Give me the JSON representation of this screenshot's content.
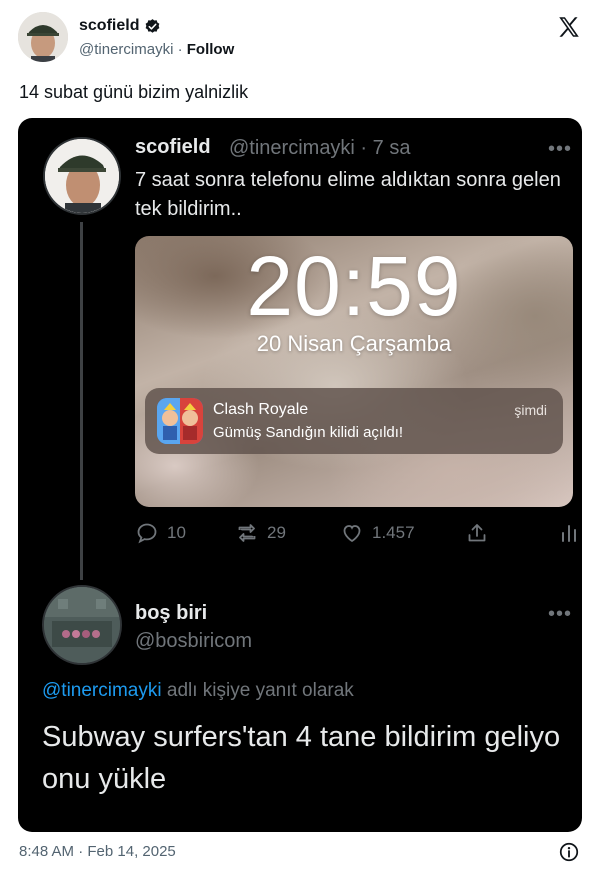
{
  "outer_tweet": {
    "author_name": "scofield",
    "handle": "@tinercimayki",
    "separator": "·",
    "follow_label": "Follow",
    "text": "14 subat günü bizim yalnizlik",
    "timestamp": "8:48 AM · Feb 14, 2025",
    "icons": {
      "verified": "verified-badge-icon",
      "logo": "x-logo-icon",
      "info": "info-icon"
    }
  },
  "quoted_screenshot": {
    "tweet": {
      "author_name": "scofield",
      "handle_time": "@tinercimayki · 7 sa",
      "more": "•••",
      "text": "7 saat sonra telefonu elime aldıktan sonra gelen tek bildirim.."
    },
    "lockscreen": {
      "time": "20:59",
      "date": "20 Nisan Çarşamba",
      "notification": {
        "app": "Clash Royale",
        "body": "Gümüş Sandığın kilidi açıldı!",
        "when": "şimdi",
        "icon": "clash-royale-app-icon"
      }
    },
    "actions": {
      "replies": "10",
      "retweets": "29",
      "likes": "1.457"
    },
    "reply": {
      "author_name": "boş biri",
      "handle": "@bosbiricom",
      "more": "•••",
      "replying_to_mention": "@tinercimayki",
      "replying_to_suffix": " adlı kişiye yanıt olarak",
      "text": "Subway surfers'tan 4 tane bildirim geliyo onu yükle"
    }
  },
  "colors": {
    "link_blue": "#1d9bf0",
    "dark_bg": "#000000",
    "muted_gray": "#71767b",
    "text_dark": "#0f1419"
  }
}
